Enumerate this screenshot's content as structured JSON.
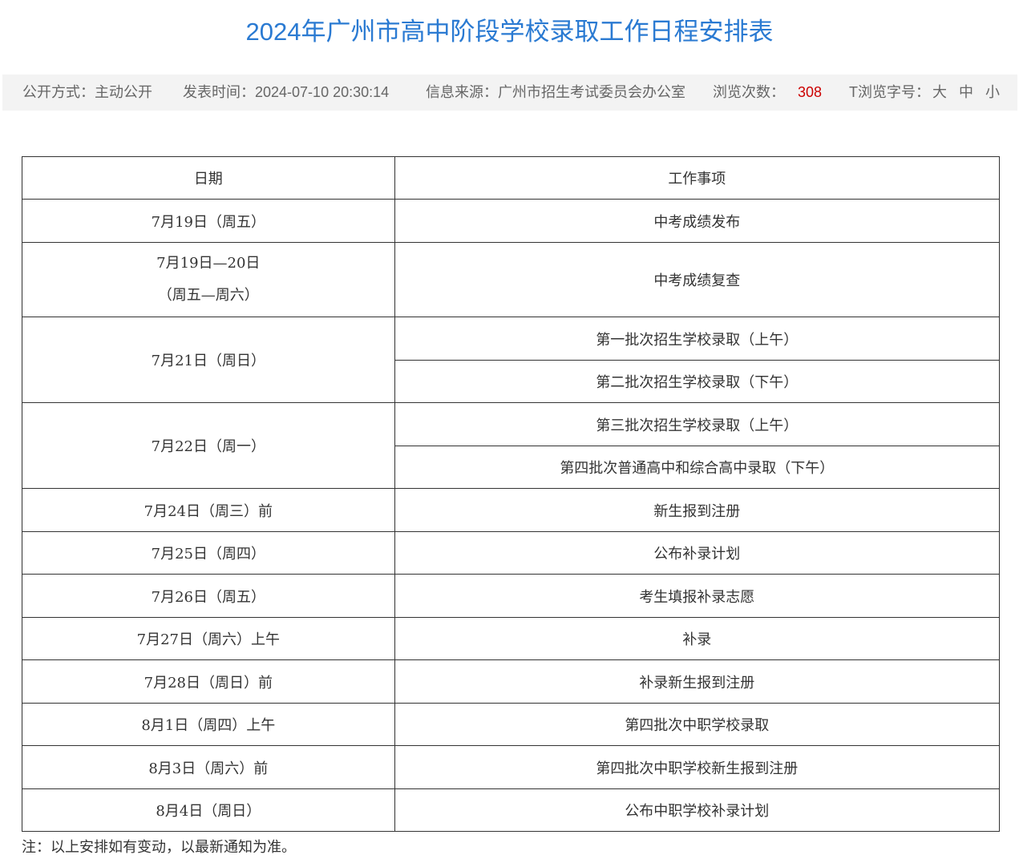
{
  "title": "2024年广州市高中阶段学校录取工作日程安排表",
  "meta": {
    "disclosure": "公开方式：主动公开",
    "publish_time": "发表时间：2024-07-10 20:30:14",
    "source": "信息来源：广州市招生考试委员会办公室",
    "views_label": "浏览次数：",
    "views_count": "308",
    "font_size_label": "T浏览字号：",
    "font_large": "大",
    "font_medium": "中",
    "font_small": "小"
  },
  "table": {
    "headers": [
      "日期",
      "工作事项"
    ],
    "rows": [
      {
        "date": "7月19日（周五）",
        "tasks": [
          "中考成绩发布"
        ]
      },
      {
        "date": "7月19日—20日",
        "date2": "（周五—周六）",
        "tasks": [
          "中考成绩复查"
        ]
      },
      {
        "date": "7月21日（周日）",
        "tasks": [
          "第一批次招生学校录取（上午）",
          "第二批次招生学校录取（下午）"
        ]
      },
      {
        "date": "7月22日（周一）",
        "tasks": [
          "第三批次招生学校录取（上午）",
          "第四批次普通高中和综合高中录取（下午）"
        ]
      },
      {
        "date": "7月24日（周三）前",
        "tasks": [
          "新生报到注册"
        ]
      },
      {
        "date": "7月25日（周四）",
        "tasks": [
          "公布补录计划"
        ]
      },
      {
        "date": "7月26日（周五）",
        "tasks": [
          "考生填报补录志愿"
        ]
      },
      {
        "date": "7月27日（周六）上午",
        "tasks": [
          "补录"
        ]
      },
      {
        "date": "7月28日（周日）前",
        "tasks": [
          "补录新生报到注册"
        ]
      },
      {
        "date": "8月1日（周四）上午",
        "tasks": [
          "第四批次中职学校录取"
        ]
      },
      {
        "date": "8月3日（周六）前",
        "tasks": [
          "第四批次中职学校新生报到注册"
        ]
      },
      {
        "date": "8月4日（周日）",
        "tasks": [
          "公布中职学校补录计划"
        ]
      }
    ]
  },
  "note": "注：以上安排如有变动，以最新通知为准。",
  "colors": {
    "title": "#2a7ad2",
    "meta_bg": "#f3f3f3",
    "views_count": "#cc0000"
  }
}
